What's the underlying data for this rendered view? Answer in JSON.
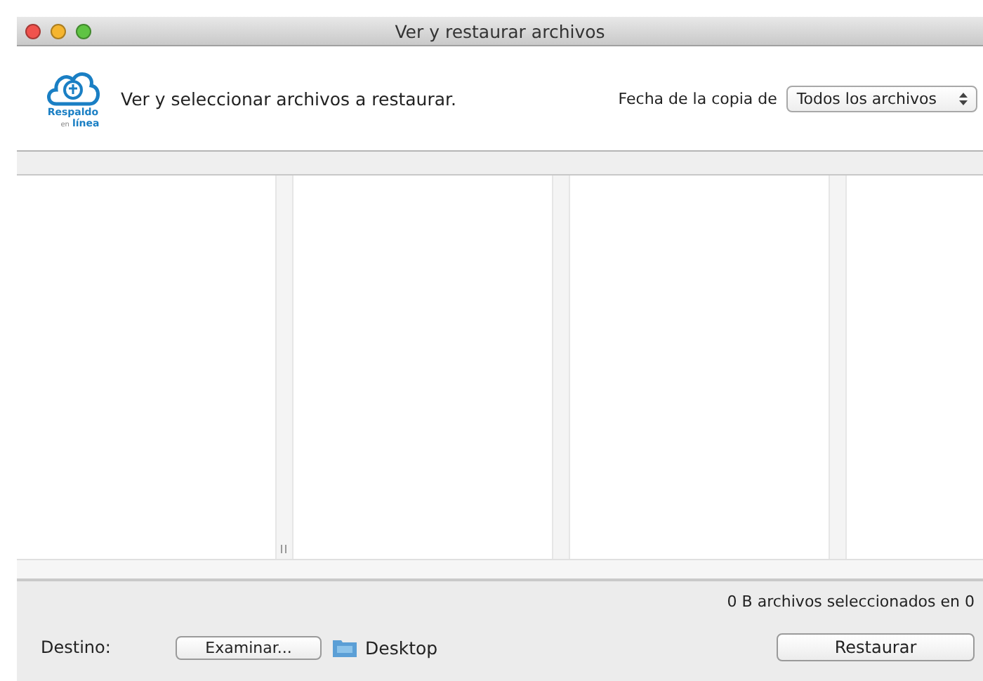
{
  "window": {
    "title": "Ver y restaurar archivos"
  },
  "header": {
    "logo": {
      "line_1": "Respaldo",
      "line_2": "en",
      "line_3": "línea"
    },
    "instruction": "Ver y seleccionar archivos a restaurar.",
    "date_label": "Fecha de la copia de",
    "date_select": {
      "value": "Todos los archivos"
    }
  },
  "footer": {
    "summary": "0 B archivos seleccionados en 0",
    "destination_label": "Destino:",
    "browse_button": "Examinar...",
    "destination": "Desktop",
    "restore_button": "Restaurar"
  }
}
